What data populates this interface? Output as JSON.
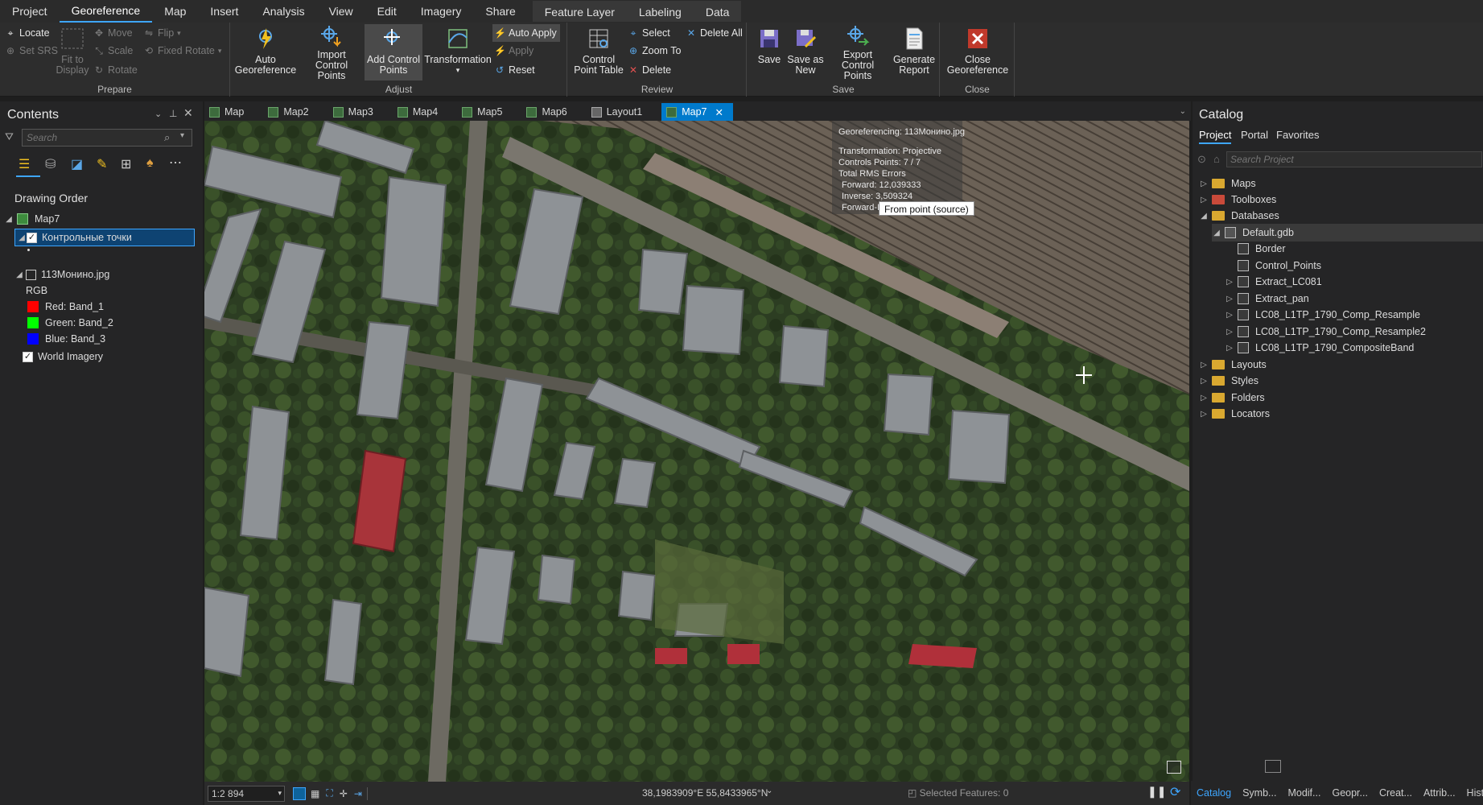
{
  "menu": {
    "items": [
      "Project",
      "Georeference",
      "Map",
      "Insert",
      "Analysis",
      "View",
      "Edit",
      "Imagery",
      "Share"
    ],
    "context": [
      "Feature Layer",
      "Labeling",
      "Data"
    ]
  },
  "ribbon": {
    "prepare": {
      "locate": "Locate",
      "set_srs": "Set SRS",
      "fit_line1": "Fit to",
      "fit_line2": "Display",
      "move": "Move",
      "scale": "Scale",
      "rotate": "Rotate",
      "flip": "Flip",
      "fixed_rotate": "Fixed Rotate",
      "label": "Prepare"
    },
    "adjust": {
      "auto_l1": "Auto",
      "auto_l2": "Georeference",
      "import_l1": "Import",
      "import_l2": "Control Points",
      "add_l1": "Add Control",
      "add_l2": "Points",
      "transformation": "Transformation",
      "auto_apply": "Auto Apply",
      "apply": "Apply",
      "reset": "Reset",
      "label": "Adjust"
    },
    "review": {
      "table_l1": "Control",
      "table_l2": "Point Table",
      "select": "Select",
      "zoom_to": "Zoom To",
      "delete": "Delete",
      "delete_all": "Delete All",
      "label": "Review"
    },
    "save": {
      "save": "Save",
      "save_as_l1": "Save as",
      "save_as_l2": "New",
      "export_l1": "Export",
      "export_l2": "Control Points",
      "report_l1": "Generate",
      "report_l2": "Report",
      "label": "Save"
    },
    "close": {
      "close_l1": "Close",
      "close_l2": "Georeference",
      "label": "Close"
    }
  },
  "contents": {
    "title": "Contents",
    "search_placeholder": "Search",
    "drawing_order": "Drawing Order",
    "map_name": "Map7",
    "layer1": "Контрольные точки",
    "layer2": "113Монино.jpg",
    "rgb": "RGB",
    "bands": [
      {
        "label": "Red:  Band_1",
        "color": "#ff0000"
      },
      {
        "label": "Green: Band_2",
        "color": "#00ff00"
      },
      {
        "label": "Blue:  Band_3",
        "color": "#0000ff"
      }
    ],
    "layer3": "World Imagery"
  },
  "tabs": [
    "Map",
    "Map2",
    "Map3",
    "Map4",
    "Map5",
    "Map6",
    "Layout1",
    "Map7"
  ],
  "overlay": {
    "title": "Georeferencing: 113Монино.jpg",
    "transformation": "Transformation: Projective",
    "points": "Controls Points: 7 / 7",
    "rms": "Total RMS Errors",
    "forward": "Forward: 12,039333",
    "inverse": "Inverse: 3,509324",
    "fi": "Forward-Inverse: 0,000000",
    "tooltip": "From point (source)"
  },
  "status": {
    "scale": "1:2 894",
    "coords": "38,1983909°E 55,8433965°N",
    "selected": "Selected Features: 0"
  },
  "catalog": {
    "title": "Catalog",
    "tabs": [
      "Project",
      "Portal",
      "Favorites"
    ],
    "search_placeholder": "Search Project",
    "items": [
      "Maps",
      "Toolboxes",
      "Databases"
    ],
    "gdb": "Default.gdb",
    "gdb_items": [
      "Border",
      "Control_Points",
      "Extract_LC081",
      "Extract_pan",
      "LC08_L1TP_1790_Comp_Resample",
      "LC08_L1TP_1790_Comp_Resample2",
      "LC08_L1TP_1790_CompositeBand"
    ],
    "more": [
      "Layouts",
      "Styles",
      "Folders",
      "Locators"
    ]
  },
  "bottom_tabs": [
    "Catalog",
    "Symb...",
    "Modif...",
    "Geopr...",
    "Creat...",
    "Attrib...",
    "Histor"
  ]
}
